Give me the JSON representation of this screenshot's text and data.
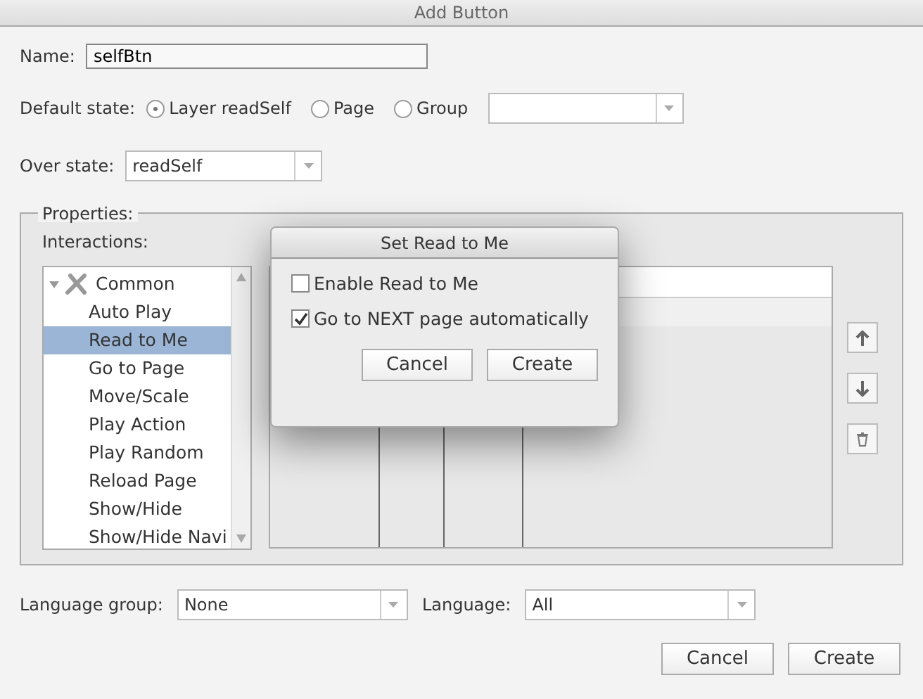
{
  "window": {
    "title": "Add Button"
  },
  "name": {
    "label": "Name:",
    "value": "selfBtn"
  },
  "default_state": {
    "label": "Default state:",
    "options": [
      {
        "label": "Layer readSelf",
        "selected": true
      },
      {
        "label": "Page",
        "selected": false
      },
      {
        "label": "Group",
        "selected": false
      }
    ]
  },
  "over_state": {
    "label": "Over state:",
    "value": "readSelf"
  },
  "properties": {
    "legend": "Properties:",
    "interactions_label": "Interactions:",
    "tree": [
      {
        "label": "Common",
        "expanded": true,
        "selected": false,
        "children": [
          {
            "label": "Auto Play",
            "selected": false
          },
          {
            "label": "Read to Me",
            "selected": true
          },
          {
            "label": "Go to Page",
            "selected": false
          },
          {
            "label": "Move/Scale",
            "selected": false
          },
          {
            "label": "Play Action",
            "selected": false
          },
          {
            "label": "Play Random",
            "selected": false
          },
          {
            "label": "Reload Page",
            "selected": false
          },
          {
            "label": "Show/Hide",
            "selected": false
          },
          {
            "label": "Show/Hide Navi",
            "selected": false
          }
        ]
      }
    ]
  },
  "language_group": {
    "label": "Language group:",
    "value": "None"
  },
  "language": {
    "label": "Language:",
    "value": "All"
  },
  "buttons": [
    "Cancel",
    "Create"
  ],
  "modal": {
    "title": "Set Read to Me",
    "checkboxes": [
      {
        "label": "Enable Read to Me",
        "checked": false
      },
      {
        "label": "Go to NEXT page automatically",
        "checked": true
      }
    ],
    "buttons": [
      "Cancel",
      "Create"
    ]
  }
}
